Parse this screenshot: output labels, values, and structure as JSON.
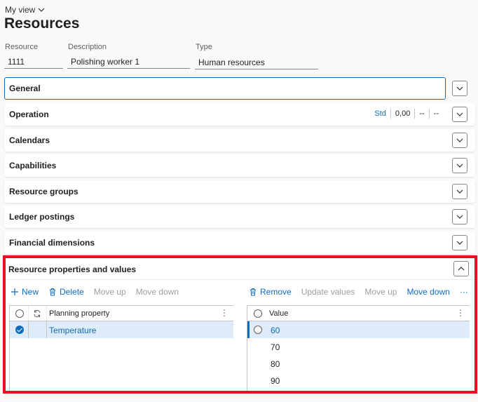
{
  "header": {
    "view_label": "My view",
    "page_title": "Resources"
  },
  "fields": {
    "resource": {
      "label": "Resource",
      "value": "1111"
    },
    "description": {
      "label": "Description",
      "value": "Polishing worker 1"
    },
    "type": {
      "label": "Type",
      "value": "Human resources"
    }
  },
  "fasttabs": {
    "general": "General",
    "operation": "Operation",
    "operation_summary": [
      "Std",
      "0,00",
      "--",
      "--"
    ],
    "calendars": "Calendars",
    "capabilities": "Capabilities",
    "resource_groups": "Resource groups",
    "ledger_postings": "Ledger postings",
    "financial_dimensions": "Financial dimensions",
    "resource_properties": "Resource properties and values"
  },
  "left_toolbar": {
    "new": "New",
    "delete": "Delete",
    "move_up": "Move up",
    "move_down": "Move down"
  },
  "right_toolbar": {
    "remove": "Remove",
    "update_values": "Update values",
    "move_up": "Move up",
    "move_down": "Move down",
    "more": "···"
  },
  "properties_grid": {
    "column_header": "Planning property",
    "rows": [
      "Temperature"
    ]
  },
  "values_grid": {
    "column_header": "Value",
    "rows": [
      "60",
      "70",
      "80",
      "90"
    ]
  },
  "colors": {
    "accent": "#0f6cbd",
    "highlight": "#e81123",
    "selected_row": "#deecf9"
  }
}
